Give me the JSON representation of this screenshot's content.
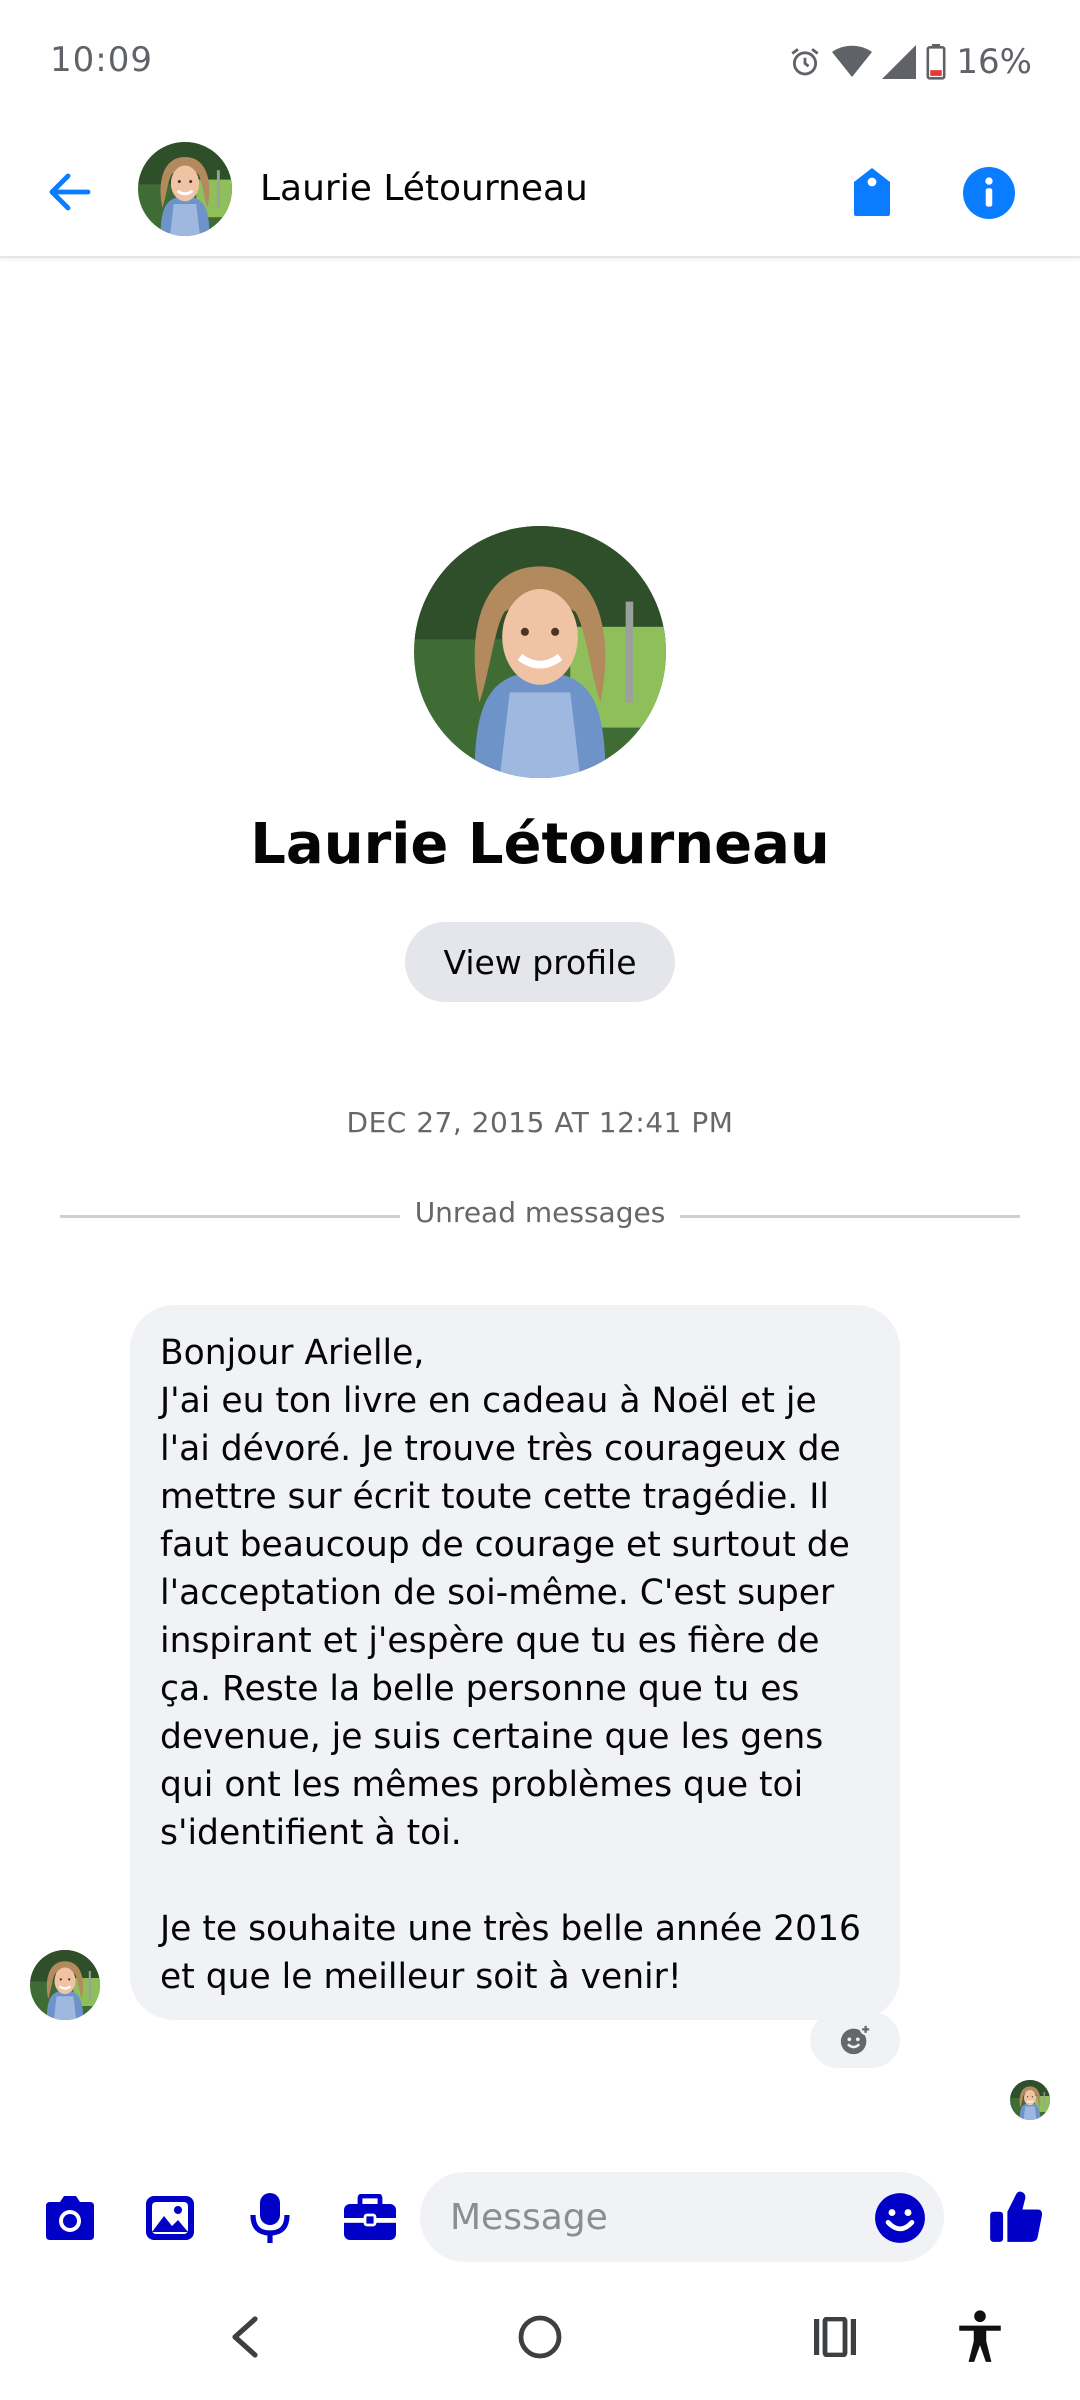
{
  "status_bar": {
    "time": "10:09",
    "battery_percent": "16%",
    "icons": [
      "alarm-icon",
      "wifi-icon",
      "signal-icon",
      "battery-icon"
    ]
  },
  "header": {
    "contact_name": "Laurie Létourneau",
    "icons": [
      "back-arrow-icon",
      "tag-icon",
      "info-icon"
    ]
  },
  "profile": {
    "name": "Laurie Létourneau",
    "view_profile_label": "View profile"
  },
  "conversation": {
    "timestamp": "DEC 27, 2015 AT 12:41 PM",
    "unread_label": "Unread messages",
    "messages": [
      {
        "sender": "Laurie Létourneau",
        "text": "Bonjour Arielle,\nJ'ai eu ton livre en cadeau à Noël et je l'ai dévoré. Je trouve très courageux de mettre sur écrit toute cette tragédie. Il faut beaucoup de courage et surtout de l'acceptation de soi-même. C'est super inspirant et j'espère que tu es fière de ça. Reste la belle personne que tu es devenue, je suis certaine que les gens qui ont les mêmes problèmes que toi s'identifient à toi.\n\nJe te souhaite une très belle année 2016 et que le meilleur soit à venir!"
      }
    ]
  },
  "composer": {
    "placeholder": "Message",
    "icons": [
      "camera-icon",
      "gallery-icon",
      "microphone-icon",
      "briefcase-icon",
      "emoji-icon",
      "thumbs-up-icon"
    ]
  },
  "colors": {
    "accent": "#0a7cff",
    "composer_accent": "#0000c7",
    "bubble": "#f0f2f5",
    "secondary_text": "#65676b"
  }
}
